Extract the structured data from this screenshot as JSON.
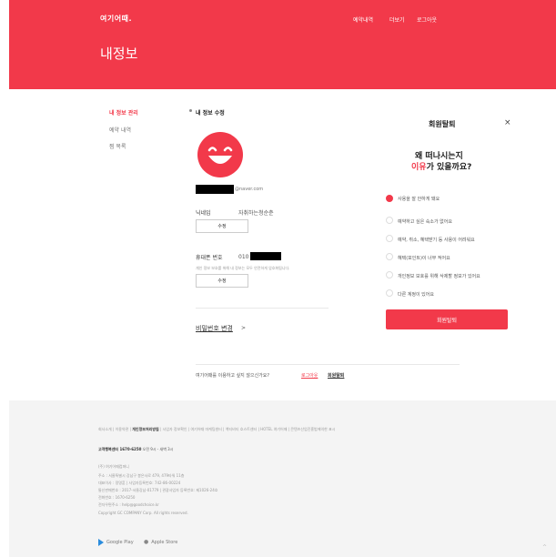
{
  "header": {
    "logo": "여기어때.",
    "nav": [
      "예약내역",
      "더보기",
      "로그아웃"
    ],
    "page_title": "내정보"
  },
  "sidebar": {
    "items": [
      "내 정보 관리",
      "예약 내역",
      "찜 목록"
    ]
  },
  "profile": {
    "section_title": "내 정보 수정",
    "email_suffix": "@naver.com",
    "nickname_label": "닉네임",
    "nickname_value": "자취하는청순춘",
    "edit_label": "수정",
    "phone_label": "휴대폰 번호",
    "phone_prefix": "010",
    "phone_note": "개인 정보 보호를 위해 내 정보는 모두 안전하게 암호화됩니다.",
    "password_link": "비밀번호 변경",
    "password_arrow": ">",
    "bottom_question": "여기어때를 이용하고 싶지 않으신가요?",
    "logout_link": "로그아웃",
    "withdraw_link": "회원탈퇴"
  },
  "withdraw_panel": {
    "title": "회원탈퇴",
    "close": "×",
    "question_line1": "왜 떠나시는지",
    "question_line2_red": "이유",
    "question_line2_rest": "가 있을까요?",
    "reasons": [
      "사용을 잘 안하게 돼요",
      "예약하고 싶은 숙소가 없어요",
      "예약, 취소, 혜택받기 등 사용이 어려워요",
      "혜택(포인트)이 너무 적어요",
      "개인정보 보호를 위해 삭제할 정보가 있어요",
      "다른 계정이 있어요"
    ],
    "selected_index": 0,
    "submit": "회원탈퇴"
  },
  "footer": {
    "links_pre": "회사소개 | 이용약관 | ",
    "links_bold": "개인정보처리방침",
    "links_post": " | 사업자 정보확인 | 여기어때 마케팅센터 | 액티비티 호스트센터 | HOTEL 여기어때 | 콘텐츠산업진흥법에의한 표시",
    "cs_bold": "고객행복센터 1670-6250",
    "cs_rest": " 오전 9시 - 새벽 3시",
    "company_lines": [
      "(주) 여기어때컴퍼니",
      "주소 : 서울특별시 강남구 봉은사로 479, 479타워 11층",
      "대표이사 : 정명훈 | 사업자등록번호: 742-86-00224",
      "통신판매번호 : 2017-서울강남-01779 | 관광사업자 등록번호: 제1026-24호",
      "전화번호 : 1670-6250",
      "전자우편주소 : help@goodchoice.kr",
      "Copyright GC COMPANY Corp. All rights reserved."
    ],
    "google_play": "Google Play",
    "apple_store": "Apple Store",
    "top_button": "^"
  },
  "colors": {
    "brand": "#f2394a"
  }
}
